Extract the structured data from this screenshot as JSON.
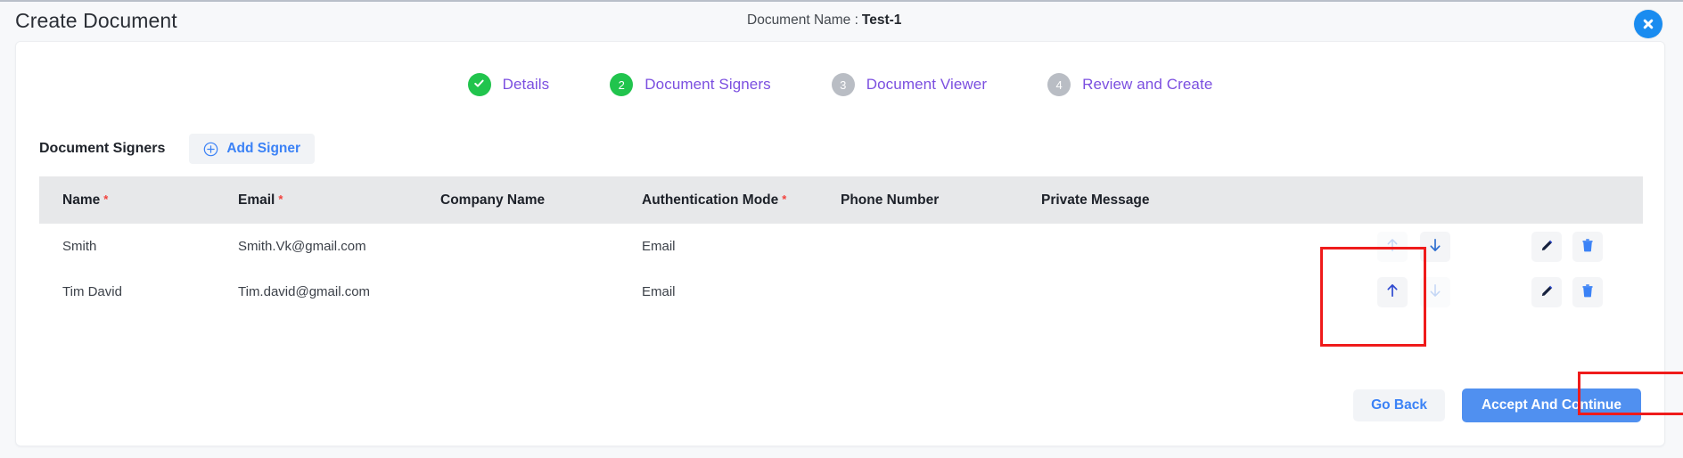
{
  "header": {
    "title": "Create Document",
    "document_name_label": "Document Name :",
    "document_name_value": "Test-1",
    "close_icon": "close-icon"
  },
  "stepper": {
    "steps": [
      {
        "number": "1",
        "label": "Details",
        "state": "done",
        "marker": "check"
      },
      {
        "number": "2",
        "label": "Document Signers",
        "state": "active",
        "marker": "2"
      },
      {
        "number": "3",
        "label": "Document Viewer",
        "state": "idle",
        "marker": "3"
      },
      {
        "number": "4",
        "label": "Review and Create",
        "state": "idle",
        "marker": "4"
      }
    ]
  },
  "signers_section": {
    "title": "Document Signers",
    "add_signer_label": "Add Signer",
    "add_signer_icon": "plus-circle-icon"
  },
  "table": {
    "columns": [
      {
        "label": "Name",
        "required": true
      },
      {
        "label": "Email",
        "required": true
      },
      {
        "label": "Company Name",
        "required": false
      },
      {
        "label": "Authentication Mode",
        "required": true
      },
      {
        "label": "Phone Number",
        "required": false
      },
      {
        "label": "Private Message",
        "required": false
      }
    ],
    "required_marker": "*",
    "rows": [
      {
        "name": "Smith",
        "email": "Smith.Vk@gmail.com",
        "company": "",
        "auth_mode": "Email",
        "phone": "",
        "private_message": "",
        "move_up_enabled": false,
        "move_down_enabled": true
      },
      {
        "name": "Tim David",
        "email": "Tim.david@gmail.com",
        "company": "",
        "auth_mode": "Email",
        "phone": "",
        "private_message": "",
        "move_up_enabled": true,
        "move_down_enabled": false
      }
    ],
    "row_icons": {
      "move_up": "arrow-up-icon",
      "move_down": "arrow-down-icon",
      "edit": "pencil-icon",
      "delete": "trash-icon"
    }
  },
  "footer": {
    "go_back_label": "Go Back",
    "accept_continue_label": "Accept And Continue"
  },
  "annotations": {
    "move_controls_highlight": "red-highlight-box",
    "accept_button_highlight": "red-highlight-box"
  },
  "colors": {
    "accent_blue": "#3b82f6",
    "primary_button": "#5090f0",
    "step_done_green": "#21c44d",
    "step_idle_gray": "#b9bdc4",
    "step_label_purple": "#7b4fe0",
    "required_red": "#f2413c",
    "highlight_red": "#ef1b1b",
    "table_header_bg": "#e7e8ea",
    "close_button_blue": "#1a8cf0"
  }
}
